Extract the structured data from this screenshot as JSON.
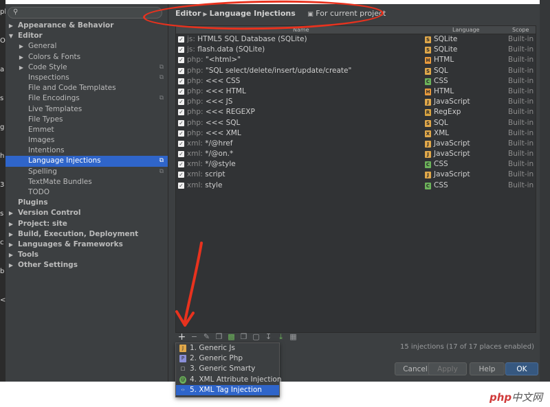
{
  "desktop": {
    "left_chars": [
      "pl",
      "O",
      "a",
      "s",
      "g",
      "h",
      "3",
      "s",
      "c",
      "b",
      "<"
    ]
  },
  "sidebar": {
    "search_placeholder": "",
    "items": [
      {
        "label": "Appearance & Behavior",
        "level": 0,
        "arrow": "collapsed",
        "bold": true
      },
      {
        "label": "Editor",
        "level": 0,
        "arrow": "expanded",
        "bold": true
      },
      {
        "label": "General",
        "level": 1,
        "arrow": "collapsed"
      },
      {
        "label": "Colors & Fonts",
        "level": 1,
        "arrow": "collapsed"
      },
      {
        "label": "Code Style",
        "level": 1,
        "arrow": "collapsed",
        "copy": true
      },
      {
        "label": "Inspections",
        "level": 1,
        "copy": true
      },
      {
        "label": "File and Code Templates",
        "level": 1
      },
      {
        "label": "File Encodings",
        "level": 1,
        "copy": true
      },
      {
        "label": "Live Templates",
        "level": 1
      },
      {
        "label": "File Types",
        "level": 1
      },
      {
        "label": "Emmet",
        "level": 1
      },
      {
        "label": "Images",
        "level": 1
      },
      {
        "label": "Intentions",
        "level": 1
      },
      {
        "label": "Language Injections",
        "level": 1,
        "copy": true,
        "selected": true
      },
      {
        "label": "Spelling",
        "level": 1,
        "copy": true
      },
      {
        "label": "TextMate Bundles",
        "level": 1
      },
      {
        "label": "TODO",
        "level": 1
      },
      {
        "label": "Plugins",
        "level": 0,
        "bold": true
      },
      {
        "label": "Version Control",
        "level": 0,
        "arrow": "collapsed",
        "bold": true
      },
      {
        "label": "Project: site",
        "level": 0,
        "arrow": "collapsed",
        "bold": true
      },
      {
        "label": "Build, Execution, Deployment",
        "level": 0,
        "arrow": "collapsed",
        "bold": true
      },
      {
        "label": "Languages & Frameworks",
        "level": 0,
        "arrow": "collapsed",
        "bold": true
      },
      {
        "label": "Tools",
        "level": 0,
        "arrow": "collapsed",
        "bold": true
      },
      {
        "label": "Other Settings",
        "level": 0,
        "arrow": "collapsed",
        "bold": true
      }
    ]
  },
  "breadcrumb": {
    "parent": "Editor",
    "current": "Language Injections",
    "project_scope": "For current project"
  },
  "table": {
    "headers": {
      "name": "Name",
      "language": "Language",
      "scope": "Scope"
    },
    "rows": [
      {
        "prefix": "js:",
        "name": "HTML5 SQL Database (SQLite)",
        "language": "SQLite",
        "icon": "sqlite",
        "scope": "Built-in"
      },
      {
        "prefix": "js:",
        "name": "flash.data (SQLite)",
        "language": "SQLite",
        "icon": "sqlite",
        "scope": "Built-in"
      },
      {
        "prefix": "php:",
        "name": "\"<html>\"",
        "language": "HTML",
        "icon": "html",
        "scope": "Built-in"
      },
      {
        "prefix": "php:",
        "name": "\"SQL select/delete/insert/update/create\"",
        "language": "SQL",
        "icon": "sql",
        "scope": "Built-in"
      },
      {
        "prefix": "php:",
        "name": "<<< CSS",
        "language": "CSS",
        "icon": "css",
        "scope": "Built-in"
      },
      {
        "prefix": "php:",
        "name": "<<< HTML",
        "language": "HTML",
        "icon": "html",
        "scope": "Built-in"
      },
      {
        "prefix": "php:",
        "name": "<<< JS",
        "language": "JavaScript",
        "icon": "js",
        "scope": "Built-in"
      },
      {
        "prefix": "php:",
        "name": "<<< REGEXP",
        "language": "RegExp",
        "icon": "regexp",
        "scope": "Built-in"
      },
      {
        "prefix": "php:",
        "name": "<<< SQL",
        "language": "SQL",
        "icon": "sql",
        "scope": "Built-in"
      },
      {
        "prefix": "php:",
        "name": "<<< XML",
        "language": "XML",
        "icon": "xml",
        "scope": "Built-in"
      },
      {
        "prefix": "xml:",
        "name": "*/@href",
        "language": "JavaScript",
        "icon": "js",
        "scope": "Built-in"
      },
      {
        "prefix": "xml:",
        "name": "*/@on.*",
        "language": "JavaScript",
        "icon": "js",
        "scope": "Built-in"
      },
      {
        "prefix": "xml:",
        "name": "*/@style",
        "language": "CSS",
        "icon": "css",
        "scope": "Built-in"
      },
      {
        "prefix": "xml:",
        "name": "script",
        "language": "JavaScript",
        "icon": "js",
        "scope": "Built-in"
      },
      {
        "prefix": "xml:",
        "name": "style",
        "language": "CSS",
        "icon": "css",
        "scope": "Built-in"
      }
    ]
  },
  "toolbar": {
    "add": "+",
    "remove": "−"
  },
  "status": "15 injections (17 of 17 places enabled)",
  "popup": {
    "items": [
      {
        "label": "1. Generic Js",
        "icon": "js"
      },
      {
        "label": "2. Generic Php",
        "icon": "php"
      },
      {
        "label": "3. Generic Smarty",
        "icon": "file"
      },
      {
        "label": "4. XML Attribute Injection",
        "icon": "xml-attr"
      },
      {
        "label": "5. XML Tag Injection",
        "icon": "xml-tag",
        "selected": true
      }
    ]
  },
  "buttons": {
    "cancel": "Cancel",
    "apply": "Apply",
    "help": "Help",
    "ok": "OK"
  },
  "watermark": {
    "php": "php",
    "site": "中文网"
  },
  "colors": {
    "selection": "#2f65ca",
    "annotation": "#e8321e",
    "icon_sqlite": "#e0a84a",
    "icon_html": "#e89a3c",
    "icon_sql": "#e0a84a",
    "icon_css": "#6cb35a",
    "icon_js": "#e0a84a",
    "icon_regexp": "#d9a441",
    "icon_xml": "#e0a84a"
  }
}
